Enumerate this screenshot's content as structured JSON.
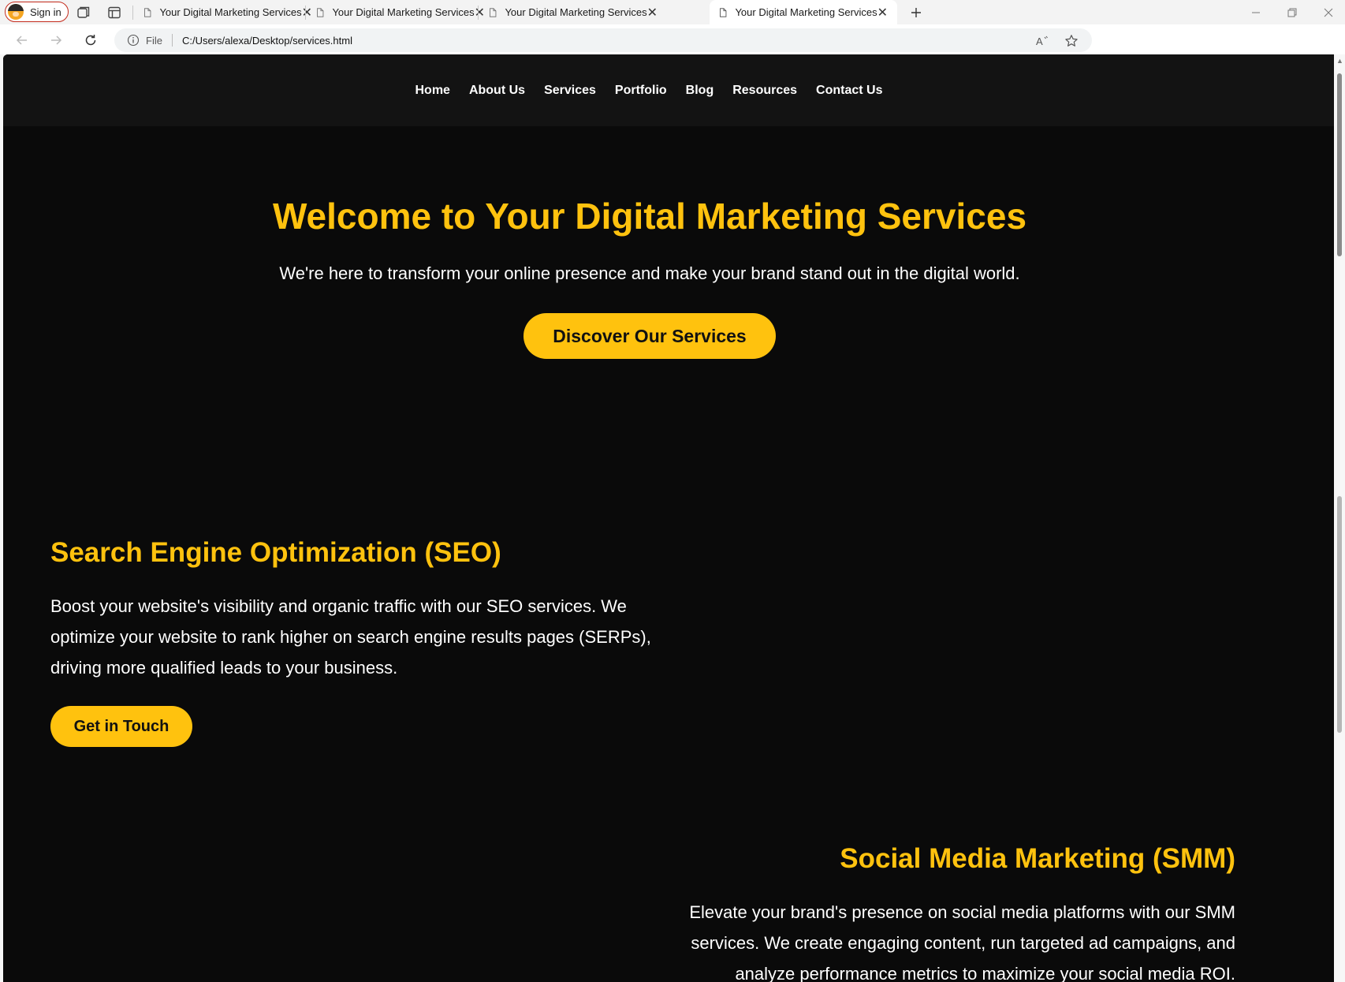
{
  "browser": {
    "signin_label": "Sign in",
    "tabs": [
      {
        "title": "Your Digital Marketing Services",
        "active": false
      },
      {
        "title": "Your Digital Marketing Services",
        "active": false
      },
      {
        "title": "Your Digital Marketing Services",
        "active": false
      },
      {
        "title": "Your Digital Marketing Services",
        "active": true
      }
    ],
    "address": {
      "scheme_label": "File",
      "url": "C:/Users/alexa/Desktop/services.html"
    },
    "icons": {
      "signin_border": "#c42b1c"
    }
  },
  "site": {
    "nav": [
      "Home",
      "About Us",
      "Services",
      "Portfolio",
      "Blog",
      "Resources",
      "Contact Us"
    ],
    "hero": {
      "title": "Welcome to Your Digital Marketing Services",
      "subtitle": "We're here to transform your online presence and make your brand stand out in the digital world.",
      "cta": "Discover Our Services"
    },
    "seo": {
      "title": "Search Engine Optimization (SEO)",
      "text": "Boost your website's visibility and organic traffic with our SEO services. We optimize your website to rank higher on search engine results pages (SERPs), driving more qualified leads to your business.",
      "cta": "Get in Touch"
    },
    "smm": {
      "title": "Social Media Marketing (SMM)",
      "text": "Elevate your brand's presence on social media platforms with our SMM services. We create engaging content, run targeted ad campaigns, and analyze performance metrics to maximize your social media ROI."
    },
    "colors": {
      "accent": "#ffc20e",
      "background": "#0a0a0a",
      "nav_background": "#131313",
      "text": "#ffffff"
    }
  }
}
